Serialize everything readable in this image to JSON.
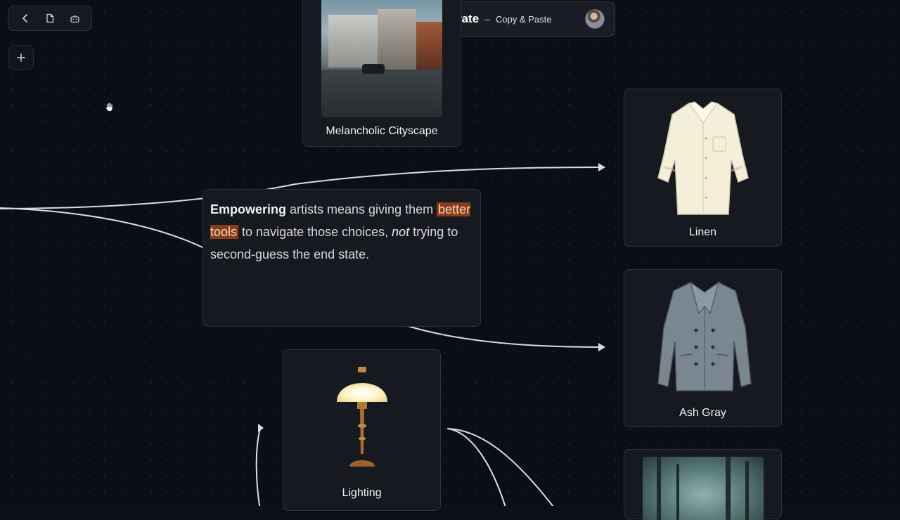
{
  "header": {
    "brand": "Pixerate",
    "separator": "–",
    "subtitle": "Copy & Paste"
  },
  "toolbar": {
    "back_icon": "chevron-left-icon",
    "document_icon": "document-icon",
    "bot_icon": "robot-icon",
    "add_icon": "plus-icon"
  },
  "cards": {
    "city": {
      "label": "Melancholic Cityscape"
    },
    "linen": {
      "label": "Linen"
    },
    "ash": {
      "label": "Ash Gray"
    },
    "lamp": {
      "label": "Lighting"
    }
  },
  "text_card": {
    "bold": "Empowering",
    "part1": " artists means giving them ",
    "highlight": "better tools",
    "part2": " to navigate those choices, ",
    "italic": "not",
    "part3": " trying to second-guess the end state."
  },
  "colors": {
    "background": "#0a0e18",
    "card": "#16191f",
    "highlight": "#8a3d14",
    "edge": "#d9dde3"
  }
}
